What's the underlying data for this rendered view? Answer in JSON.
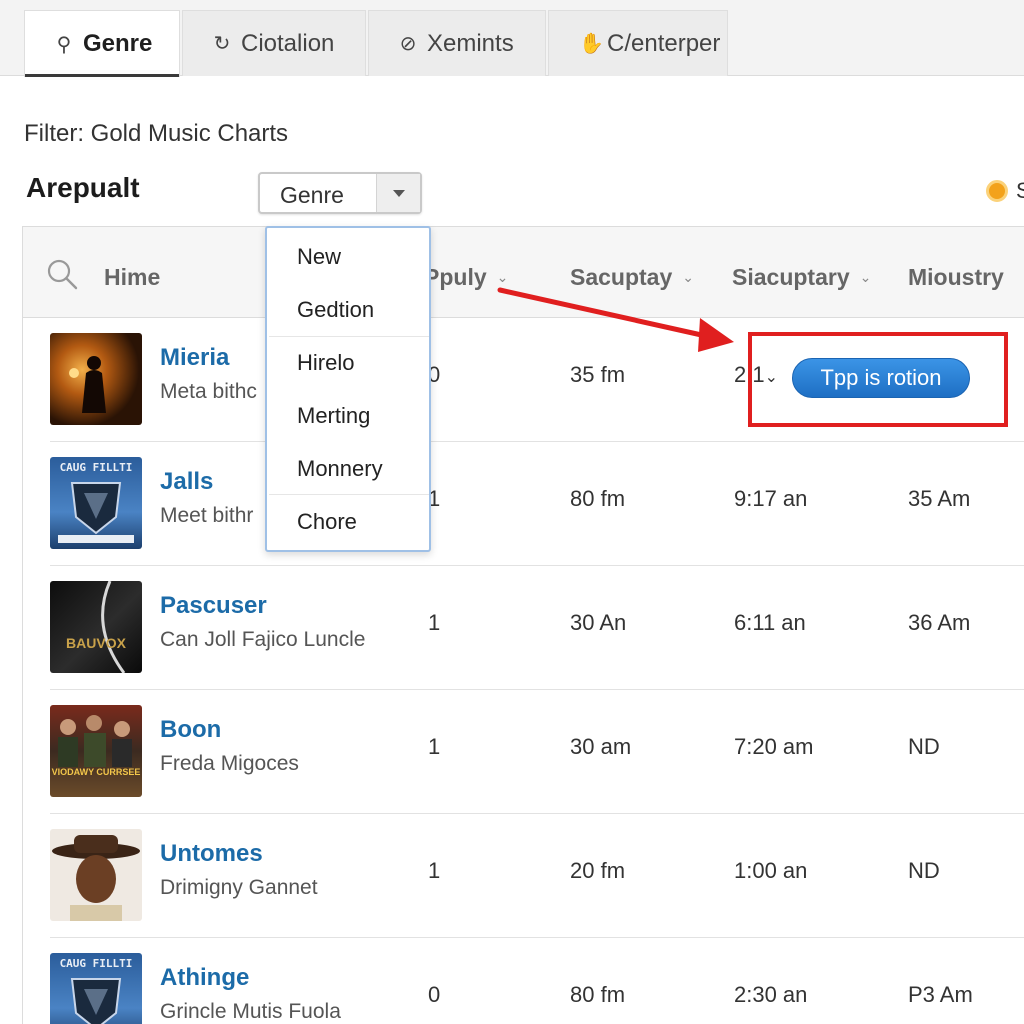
{
  "tabs": [
    {
      "label": "Genre",
      "icon": "pin-icon",
      "glyph": "⚲",
      "active": true
    },
    {
      "label": "Ciotalion",
      "icon": "refresh-icon",
      "glyph": "↻",
      "active": false
    },
    {
      "label": "Xemints",
      "icon": "circle-slash-icon",
      "glyph": "⊘",
      "active": false
    },
    {
      "label": "C/enterper",
      "icon": "hand-icon",
      "glyph": "✋",
      "active": false
    }
  ],
  "filter": {
    "label": "Filter: Gold Music Charts"
  },
  "section": {
    "title": "Arepualt"
  },
  "genre_select": {
    "value": "Genre"
  },
  "status": {
    "peek": "S"
  },
  "columns": {
    "search": "Hime",
    "col1": "Ppuly",
    "col2": "Sacuptay",
    "col3": "Siacuptary",
    "col4": "Mioustry"
  },
  "dropdown": {
    "items": [
      "New",
      "Gedtion",
      "Hirelo",
      "Merting",
      "Monnery",
      "Chore"
    ]
  },
  "rows": [
    {
      "title": "Mieria",
      "subtitle": "Meta bithc",
      "c1": "0",
      "c2": "35 fm",
      "c3": "2 1",
      "c4": "",
      "art": "silhouette"
    },
    {
      "title": "Jalls",
      "subtitle": "Meet bithr",
      "c1": "1",
      "c2": "80 fm",
      "c3": "9:17 an",
      "c4": "35 Am",
      "art": "shield"
    },
    {
      "title": "Pascuser",
      "subtitle": "Can Joll Fajico Luncle",
      "c1": "1",
      "c2": "30 An",
      "c3": "6:11 an",
      "c4": "36 Am",
      "art": "dark"
    },
    {
      "title": "Boon",
      "subtitle": "Freda Migoces",
      "c1": "1",
      "c2": "30 am",
      "c3": "7:20 am",
      "c4": "ND",
      "art": "group"
    },
    {
      "title": "Untomes",
      "subtitle": "Drimigny Gannet",
      "c1": "1",
      "c2": "20 fm",
      "c3": "1:00 an",
      "c4": "ND",
      "art": "portrait"
    },
    {
      "title": "Athinge",
      "subtitle": "Grincle Mutis Fuola",
      "c1": "0",
      "c2": "80 fm",
      "c3": "2:30 an",
      "c4": "P3 Am",
      "art": "shield"
    }
  ],
  "action": {
    "label": "Tpp is rotion"
  },
  "album_text": {
    "shield": "CAUG FILLTI",
    "dark": "BAUVOX",
    "group": "VIODAWY CURRSEE"
  },
  "colors": {
    "accent": "#1e6fc4",
    "annotation": "#e01f1f",
    "link": "#1c6ba8"
  }
}
